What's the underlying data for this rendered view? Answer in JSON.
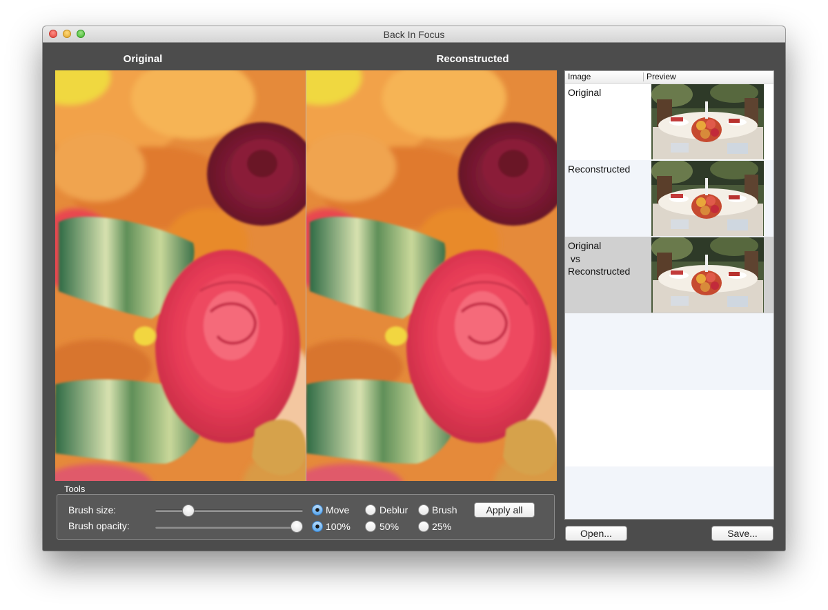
{
  "window": {
    "title": "Back In Focus"
  },
  "panes": {
    "original_title": "Original",
    "reconstructed_title": "Reconstructed"
  },
  "tools": {
    "group_label": "Tools",
    "brush_size_label": "Brush size:",
    "brush_size_level": 0.2,
    "brush_opacity_label": "Brush opacity:",
    "brush_opacity_level": 1.0,
    "mode_options": [
      "Move",
      "Deblur",
      "Brush"
    ],
    "mode_selected": "Move",
    "opacity_options": [
      "100%",
      "50%",
      "25%"
    ],
    "opacity_selected": "100%",
    "apply_all_label": "Apply all"
  },
  "table": {
    "columns": [
      "Image",
      "Preview"
    ],
    "rows": [
      {
        "name": "Original",
        "selected": false
      },
      {
        "name": "Reconstructed",
        "selected": false
      },
      {
        "name": "Original\n vs\nReconstructed",
        "selected": true
      }
    ]
  },
  "buttons": {
    "open_label": "Open...",
    "save_label": "Save..."
  }
}
